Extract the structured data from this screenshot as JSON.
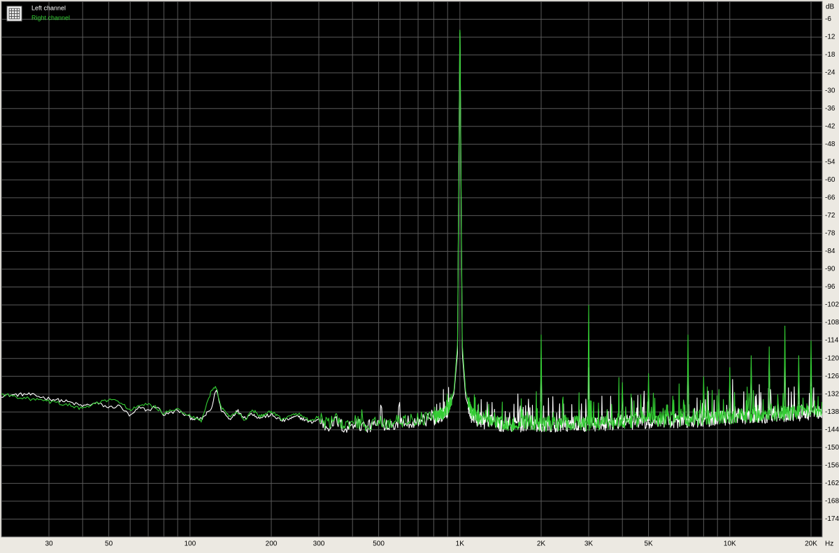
{
  "chart_data": {
    "type": "line",
    "title": "",
    "xlabel": "",
    "ylabel": "",
    "x_scale": "log",
    "xlim": [
      20,
      22000
    ],
    "ylim": [
      -180,
      0
    ],
    "x_unit": "Hz",
    "y_unit": "dB",
    "grid": true,
    "legend_position": "top-left",
    "x_ticks": [
      {
        "value": 30,
        "label": "30"
      },
      {
        "value": 50,
        "label": "50"
      },
      {
        "value": 100,
        "label": "100"
      },
      {
        "value": 200,
        "label": "200"
      },
      {
        "value": 300,
        "label": "300"
      },
      {
        "value": 500,
        "label": "500"
      },
      {
        "value": 1000,
        "label": "1K"
      },
      {
        "value": 2000,
        "label": "2K"
      },
      {
        "value": 3000,
        "label": "3K"
      },
      {
        "value": 5000,
        "label": "5K"
      },
      {
        "value": 10000,
        "label": "10K"
      },
      {
        "value": 20000,
        "label": "20K"
      }
    ],
    "y_ticks": [
      -6,
      -12,
      -18,
      -24,
      -30,
      -36,
      -42,
      -48,
      -54,
      -60,
      -66,
      -72,
      -78,
      -84,
      -90,
      -96,
      -102,
      -108,
      -114,
      -120,
      -126,
      -132,
      -138,
      -144,
      -150,
      -156,
      -162,
      -168,
      -174
    ],
    "series": [
      {
        "name": "Left channel",
        "color": "#ffffff",
        "points": [
          [
            20,
            -132.5
          ],
          [
            25,
            -132
          ],
          [
            30,
            -133.5
          ],
          [
            35,
            -134.5
          ],
          [
            40,
            -136
          ],
          [
            45,
            -135
          ],
          [
            50,
            -136.5
          ],
          [
            55,
            -136
          ],
          [
            60,
            -139.5
          ],
          [
            65,
            -136.5
          ],
          [
            70,
            -137.5
          ],
          [
            75,
            -136
          ],
          [
            80,
            -139
          ],
          [
            90,
            -137.5
          ],
          [
            100,
            -140
          ],
          [
            110,
            -140.5
          ],
          [
            120,
            -137
          ],
          [
            125,
            -130
          ],
          [
            130,
            -137
          ],
          [
            140,
            -140.5
          ],
          [
            150,
            -137.5
          ],
          [
            160,
            -140
          ],
          [
            170,
            -138.5
          ],
          [
            180,
            -140
          ],
          [
            200,
            -139
          ],
          [
            220,
            -141
          ],
          [
            250,
            -139.5
          ],
          [
            280,
            -141.5
          ],
          [
            300,
            -140.5
          ],
          [
            320,
            -143
          ],
          [
            350,
            -141
          ],
          [
            380,
            -144
          ],
          [
            400,
            -141.5
          ],
          [
            450,
            -143
          ],
          [
            500,
            -142
          ],
          [
            550,
            -142
          ],
          [
            600,
            -141.5
          ],
          [
            700,
            -141
          ],
          [
            800,
            -140.5
          ],
          [
            900,
            -138
          ],
          [
            950,
            -132
          ],
          [
            980,
            -118
          ],
          [
            1000,
            -6
          ],
          [
            1020,
            -118
          ],
          [
            1050,
            -133
          ],
          [
            1100,
            -139
          ],
          [
            1200,
            -141
          ],
          [
            1400,
            -142
          ],
          [
            1600,
            -142.5
          ],
          [
            1800,
            -142
          ],
          [
            2000,
            -142.5
          ],
          [
            2500,
            -142
          ],
          [
            3000,
            -142.5
          ],
          [
            3500,
            -142
          ],
          [
            4000,
            -141.5
          ],
          [
            5000,
            -141
          ],
          [
            6000,
            -141
          ],
          [
            8000,
            -140.5
          ],
          [
            10000,
            -140
          ],
          [
            12000,
            -139.5
          ],
          [
            15000,
            -139
          ],
          [
            18000,
            -138.5
          ],
          [
            20000,
            -138
          ],
          [
            22000,
            -137.5
          ]
        ],
        "harmonics": [
          [
            2000,
            -120
          ],
          [
            3000,
            -123
          ],
          [
            4000,
            -131
          ],
          [
            5000,
            -130
          ],
          [
            7000,
            -121
          ],
          [
            8000,
            -130
          ],
          [
            10000,
            -127
          ],
          [
            12000,
            -123
          ],
          [
            14000,
            -119
          ],
          [
            16000,
            -120
          ],
          [
            18000,
            -126
          ],
          [
            20000,
            -124
          ]
        ]
      },
      {
        "name": "Right channel",
        "color": "#33cc33",
        "points": [
          [
            20,
            -132
          ],
          [
            25,
            -133.5
          ],
          [
            30,
            -134.5
          ],
          [
            35,
            -135.5
          ],
          [
            40,
            -137
          ],
          [
            45,
            -135
          ],
          [
            50,
            -134
          ],
          [
            55,
            -134.5
          ],
          [
            60,
            -137.5
          ],
          [
            65,
            -136
          ],
          [
            70,
            -135.5
          ],
          [
            75,
            -136.5
          ],
          [
            80,
            -138.5
          ],
          [
            90,
            -137
          ],
          [
            100,
            -139.5
          ],
          [
            110,
            -141
          ],
          [
            115,
            -136
          ],
          [
            120,
            -131
          ],
          [
            125,
            -129.5
          ],
          [
            130,
            -136
          ],
          [
            140,
            -139.5
          ],
          [
            150,
            -138
          ],
          [
            160,
            -141
          ],
          [
            170,
            -137
          ],
          [
            180,
            -139.5
          ],
          [
            200,
            -138
          ],
          [
            220,
            -140.5
          ],
          [
            250,
            -138.5
          ],
          [
            280,
            -141
          ],
          [
            300,
            -139.5
          ],
          [
            320,
            -142
          ],
          [
            350,
            -140.5
          ],
          [
            380,
            -143
          ],
          [
            400,
            -141
          ],
          [
            450,
            -142.5
          ],
          [
            500,
            -141.5
          ],
          [
            550,
            -141.5
          ],
          [
            600,
            -141
          ],
          [
            700,
            -140.5
          ],
          [
            800,
            -140
          ],
          [
            900,
            -137.5
          ],
          [
            950,
            -131
          ],
          [
            980,
            -115
          ],
          [
            1000,
            -5
          ],
          [
            1020,
            -115
          ],
          [
            1050,
            -131
          ],
          [
            1100,
            -138.5
          ],
          [
            1200,
            -140.5
          ],
          [
            1400,
            -141.5
          ],
          [
            1600,
            -142
          ],
          [
            1800,
            -141.5
          ],
          [
            2000,
            -142
          ],
          [
            2500,
            -141.5
          ],
          [
            3000,
            -142
          ],
          [
            3500,
            -141.5
          ],
          [
            4000,
            -141
          ],
          [
            5000,
            -140.5
          ],
          [
            6000,
            -140.5
          ],
          [
            8000,
            -140
          ],
          [
            10000,
            -139.5
          ],
          [
            12000,
            -139
          ],
          [
            15000,
            -138.5
          ],
          [
            18000,
            -138
          ],
          [
            20000,
            -137.5
          ],
          [
            22000,
            -137
          ]
        ],
        "harmonics": [
          [
            2000,
            -112
          ],
          [
            3000,
            -102
          ],
          [
            4000,
            -128
          ],
          [
            5000,
            -125
          ],
          [
            7000,
            -112
          ],
          [
            8000,
            -126
          ],
          [
            10000,
            -123
          ],
          [
            12000,
            -119
          ],
          [
            14000,
            -116
          ],
          [
            16000,
            -109
          ],
          [
            18000,
            -119
          ],
          [
            20000,
            -114
          ]
        ]
      }
    ]
  }
}
